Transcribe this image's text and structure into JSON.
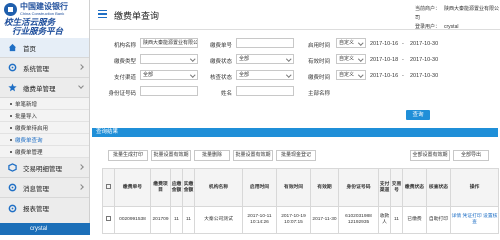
{
  "brand": {
    "cn_name": "中国建设银行",
    "en_name": "China Construction Bank",
    "slogan_line1": "校生活云服务",
    "slogan_line2": "行业服务平台"
  },
  "sidebar": {
    "items": [
      {
        "label": "首页",
        "icon": "home-icon"
      },
      {
        "label": "系统管理",
        "icon": "gear-icon"
      },
      {
        "label": "缴费单管理",
        "icon": "star-icon"
      }
    ],
    "sub_items": [
      "单笔新增",
      "批量导入",
      "缴费单待启用",
      "缴费单查询",
      "缴费单管理"
    ],
    "lower_items": [
      {
        "label": "交易明细管理",
        "icon": "cube-icon"
      },
      {
        "label": "消息管理",
        "icon": "gear-icon"
      },
      {
        "label": "报表管理",
        "icon": "gear-icon"
      }
    ],
    "footer_user": "crystal"
  },
  "header": {
    "title": "缴费单查询",
    "current_org_label": "当前商户：",
    "current_org_value": "陕西大秦能源置业有限公司",
    "user_label": "登录用户：",
    "user_value": "crystal"
  },
  "form": {
    "org_label": "机构名称",
    "org_value": "陕西大秦能源置业有限公司",
    "bill_no_label": "缴费单号",
    "start_time_label": "启用时间",
    "start_time_option": "自定义",
    "start_from": "2017-10-16",
    "start_sep": "-",
    "start_to": "2017-10-30",
    "type_label": "缴费类型",
    "status_label": "缴费状态",
    "status_value": "全部",
    "valid_time_label": "有效时间",
    "valid_time_option": "自定义",
    "valid_from": "2017-10-18",
    "valid_sep": "-",
    "valid_to": "2017-10-30",
    "pay_channel_label": "支付渠道",
    "pay_channel_value": "全部",
    "verify_status_label": "核查状态",
    "verify_status_value": "全部",
    "pay_time_label": "缴费时间",
    "pay_time_option": "自定义",
    "pay_from": "2017-10-16",
    "pay_sep": "-",
    "pay_to": "2017-10-30",
    "id_label": "身份证号码",
    "name_label": "姓名",
    "main_org_label": "主部名称",
    "query_button": "查询"
  },
  "results": {
    "title": "查询结果",
    "buttons": [
      "批量生成打印",
      "批量设置有效期",
      "批量删除",
      "批量设置有效期",
      "批量现金登记",
      "全部设置有效期",
      "全部导出"
    ]
  },
  "table": {
    "headers": [
      "",
      "缴费单号",
      "缴费项目",
      "应缴金额",
      "实缴金额",
      "机构名称",
      "启用时间",
      "有效时间",
      "有效期",
      "身份证号码",
      "支付渠道",
      "交易号",
      "缴费状态",
      "核查状态",
      "操作"
    ],
    "rows": [
      [
        "",
        "0020991538",
        "201709",
        "11",
        "11",
        "大秦公司测试",
        "2017-10-11 10:14:26",
        "2017-10-19 10:07:15",
        "2017-11-30",
        "6102031988 12192935",
        "收款人",
        "11",
        "已缴费",
        "自助打印",
        "详情 凭证打印 设置核查"
      ]
    ]
  }
}
